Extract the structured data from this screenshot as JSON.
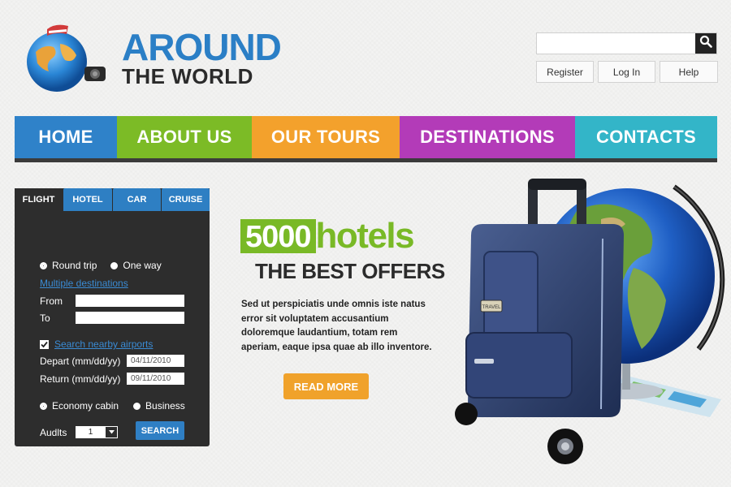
{
  "logo": {
    "line1": "AROUND",
    "line2": "THE WORLD"
  },
  "search": {
    "placeholder": "",
    "value": ""
  },
  "top_links": [
    "Register",
    "Log In",
    "Help"
  ],
  "nav": [
    {
      "label": "HOME",
      "color": "#2f82c9"
    },
    {
      "label": "ABOUT US",
      "color": "#7cbb26"
    },
    {
      "label": "OUR TOURS",
      "color": "#f3a12c"
    },
    {
      "label": "DESTINATIONS",
      "color": "#b33bb8"
    },
    {
      "label": "CONTACTS",
      "color": "#33b5c8"
    }
  ],
  "booking": {
    "tabs": [
      "FLIGHT",
      "HOTEL",
      "CAR",
      "CRUISE"
    ],
    "active_tab": "FLIGHT",
    "trip_round": "Round trip",
    "trip_oneway": "One way",
    "multi_link": "Multiple destinations",
    "from_label": "From",
    "from_value": "",
    "to_label": "To",
    "to_value": "",
    "nearby_link": "Search nearby airports",
    "nearby_checked": true,
    "depart_label": "Depart (mm/dd/yy)",
    "depart_value": "04/11/2010",
    "return_label": "Return (mm/dd/yy)",
    "return_value": "09/11/2010",
    "cabin_economy": "Economy cabin",
    "cabin_business": "Business",
    "adults_label": "Audlts",
    "adults_value": "1",
    "search_label": "SEARCH"
  },
  "promo": {
    "number": "5000",
    "word": "hotels",
    "subtitle": "THE BEST OFFERS",
    "description": "Sed ut perspiciatis unde omnis iste natus error sit voluptatem accusantium doloremque laudantium, totam rem aperiam, eaque ipsa quae ab illo inventore.",
    "button": "READ MORE",
    "luggage_tag": "TRAVEL"
  }
}
